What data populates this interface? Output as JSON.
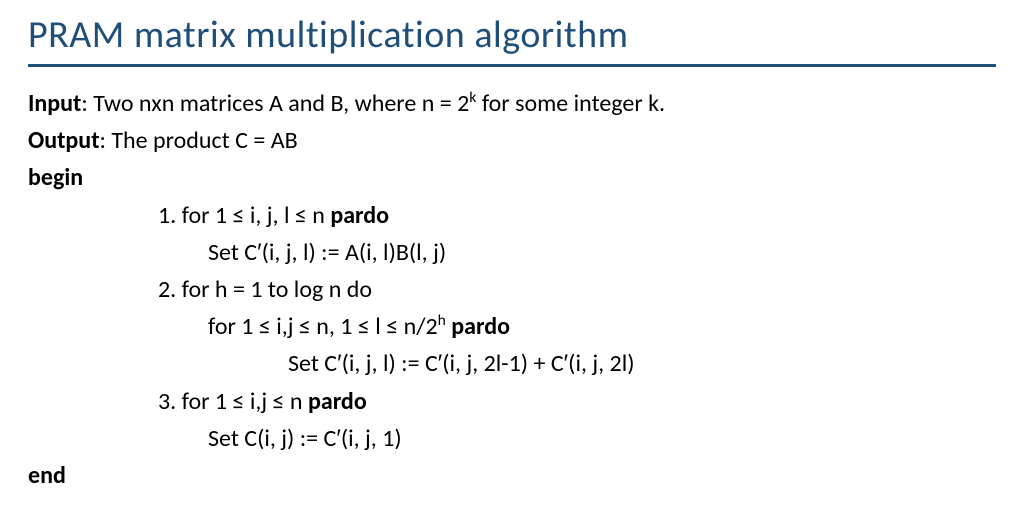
{
  "title": "PRAM matrix multiplication algorithm",
  "input": {
    "label": "Input",
    "pre": ": Two nxn matrices A and B, where n = 2",
    "sup": "k",
    "post": " for some integer k."
  },
  "output": {
    "label": "Output",
    "text": ": The product C = AB"
  },
  "begin": "begin",
  "end": "end",
  "step1": {
    "pre": "1. for 1 ≤ i, j, l ≤ n ",
    "kw": "pardo",
    "body": "Set C′(i, j, l) := A(i, l)B(l, j)"
  },
  "step2": {
    "head": "2. for h = 1 to log n do",
    "inner_pre": "for 1 ≤ i,j ≤ n, 1 ≤ l ≤ n/2",
    "inner_sup": "h",
    "inner_kw": " pardo",
    "body": "Set C′(i, j, l) := C′(i, j, 2l-1) + C′(i, j, 2l)"
  },
  "step3": {
    "pre": "3. for 1 ≤ i,j ≤ n ",
    "kw": "pardo",
    "body": "Set C(i, j) := C′(i, j, 1)"
  }
}
